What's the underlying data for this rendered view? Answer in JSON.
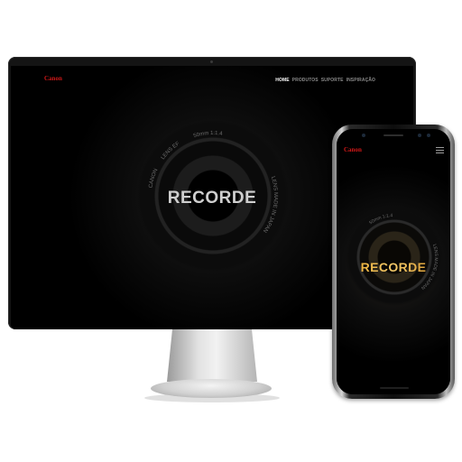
{
  "desktop": {
    "logo": "Canon",
    "nav": [
      "HOME",
      "PRODUTOS",
      "SUPORTE",
      "INSPIRAÇÃO"
    ],
    "active_nav": "HOME",
    "headline": "RECORDE",
    "lens_text": [
      "CANON",
      "LENS EF",
      "50mm 1:1.4",
      "LENS MADE IN JAPAN"
    ]
  },
  "mobile": {
    "logo": "Canon",
    "menu_icon": "hamburger-icon",
    "headline": "RECORDE",
    "lens_text": [
      "50mm 1:1.4",
      "LENS MADE IN JAPAN"
    ]
  },
  "colors": {
    "brand_red": "#d31818",
    "headline_desktop": "#cfcfcf",
    "headline_mobile": "#f0b848"
  }
}
